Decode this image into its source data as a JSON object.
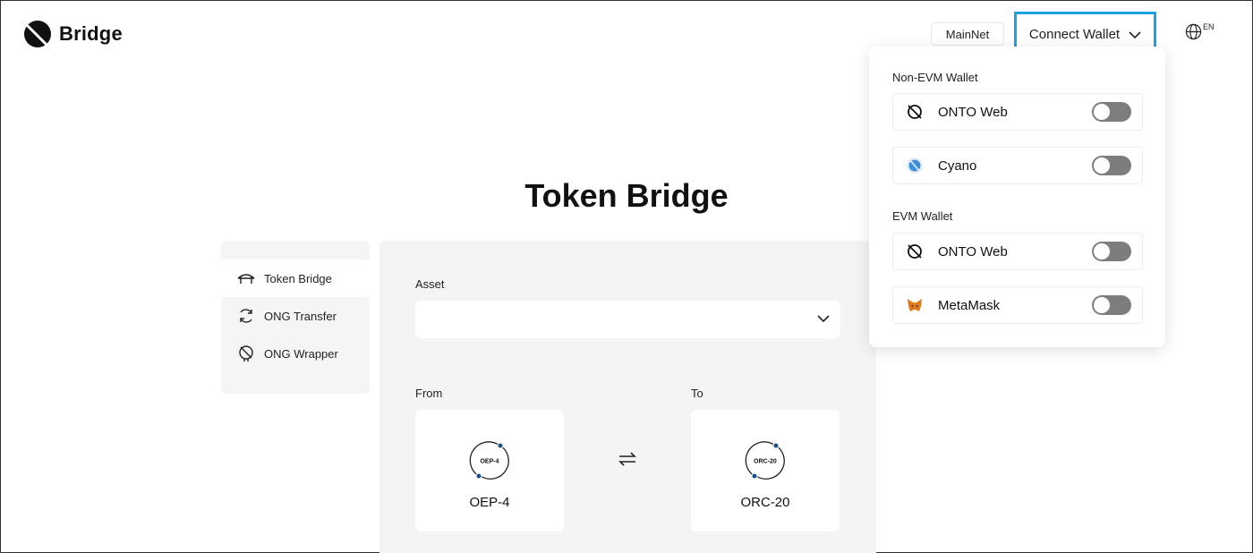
{
  "header": {
    "brand": "Bridge",
    "network_label": "MainNet",
    "connect_label": "Connect Wallet",
    "language": "EN"
  },
  "title": "Token Bridge",
  "sidebar": {
    "items": [
      {
        "label": "Token Bridge",
        "icon": "bridge-icon",
        "active": true
      },
      {
        "label": "ONG Transfer",
        "icon": "refresh-icon",
        "active": false
      },
      {
        "label": "ONG Wrapper",
        "icon": "wrapper-icon",
        "active": false
      }
    ]
  },
  "form": {
    "asset_label": "Asset",
    "asset_value": "",
    "from_label": "From",
    "to_label": "To",
    "from_chain": {
      "name": "OEP-4",
      "icon_text": "OEP-4"
    },
    "to_chain": {
      "name": "ORC-20",
      "icon_text": "ORC-20"
    }
  },
  "wallet_menu": {
    "non_evm_label": "Non-EVM Wallet",
    "evm_label": "EVM Wallet",
    "non_evm_wallets": [
      {
        "name": "ONTO Web",
        "icon": "onto-icon",
        "enabled": false
      },
      {
        "name": "Cyano",
        "icon": "cyano-icon",
        "enabled": false
      }
    ],
    "evm_wallets": [
      {
        "name": "ONTO Web",
        "icon": "onto-icon",
        "enabled": false
      },
      {
        "name": "MetaMask",
        "icon": "metamask-icon",
        "enabled": false
      }
    ]
  },
  "colors": {
    "accent_outline": "#1aa3e0",
    "toggle_off": "#7d7d7d",
    "panel_bg": "#f4f4f4"
  }
}
